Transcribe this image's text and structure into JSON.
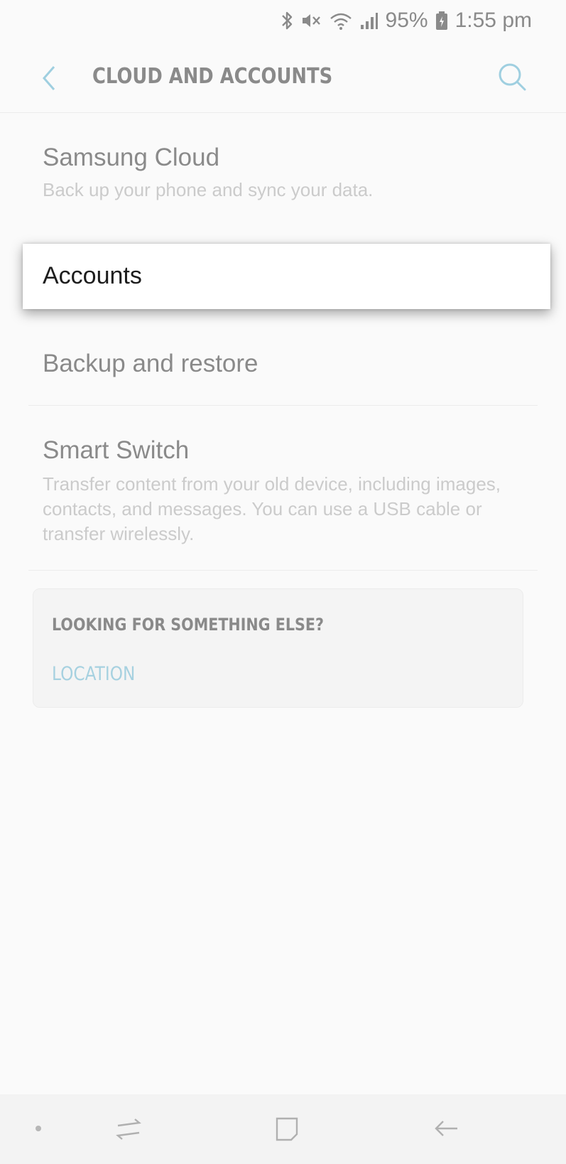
{
  "status_bar": {
    "battery_pct": "95%",
    "time": "1:55 pm",
    "icons": [
      "bluetooth-icon",
      "mute-icon",
      "wifi-icon",
      "signal-icon",
      "battery-icon"
    ]
  },
  "app_bar": {
    "title": "CLOUD AND ACCOUNTS",
    "icons": [
      "back-icon",
      "search-icon"
    ],
    "accent_color": "#9fcfe0"
  },
  "items": [
    {
      "title": "Samsung Cloud",
      "description": "Back up your phone and sync your data."
    },
    {
      "title": "Accounts"
    },
    {
      "title": "Backup and restore"
    },
    {
      "title": "Smart Switch",
      "description": "Transfer content from your old device, including images, contacts, and messages. You can use a USB cable or transfer wirelessly."
    }
  ],
  "suggestions": {
    "heading": "LOOKING FOR SOMETHING ELSE?",
    "link": "LOCATION",
    "link_color": "#a6d1e0"
  },
  "nav_bar": {
    "icons": [
      "recent-apps-icon",
      "home-icon",
      "nav-back-icon"
    ]
  }
}
